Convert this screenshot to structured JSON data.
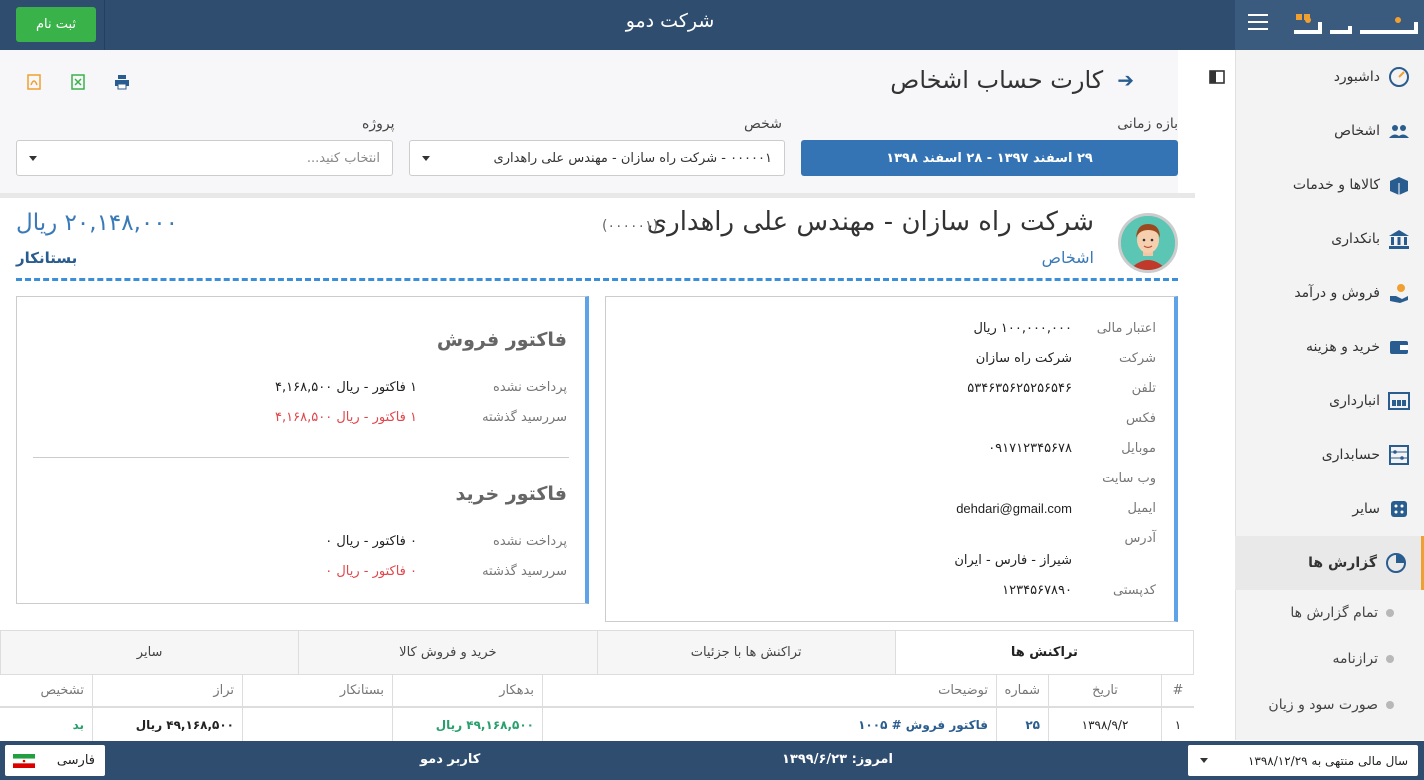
{
  "topbar": {
    "company": "شرکت دمو",
    "signup_label": "ثبت نام"
  },
  "sidebar": {
    "items": [
      {
        "label": "داشبورد",
        "icon": "dashboard-icon"
      },
      {
        "label": "اشخاص",
        "icon": "people-icon"
      },
      {
        "label": "کالاها و خدمات",
        "icon": "box-icon"
      },
      {
        "label": "بانکداری",
        "icon": "bank-icon"
      },
      {
        "label": "فروش و درآمد",
        "icon": "sales-icon"
      },
      {
        "label": "خرید و هزینه",
        "icon": "wallet-icon"
      },
      {
        "label": "انبارداری",
        "icon": "warehouse-icon"
      },
      {
        "label": "حسابداری",
        "icon": "abacus-icon"
      },
      {
        "label": "سایر",
        "icon": "misc-icon"
      },
      {
        "label": "گزارش ها",
        "icon": "report-icon"
      }
    ],
    "sub_items": [
      "تمام گزارش ها",
      "ترازنامه",
      "صورت سود و زیان"
    ]
  },
  "page": {
    "title": "کارت حساب اشخاص",
    "filters": {
      "range_label": "بازه زمانی",
      "range_value": "۲۹ اسفند ۱۳۹۷ - ۲۸ اسفند ۱۳۹۸",
      "person_label": "شخص",
      "person_value": "۰۰۰۰۰۱ - شرکت راه سازان - مهندس علی راهداری",
      "project_label": "پروژه",
      "project_placeholder": "انتخاب کنید..."
    }
  },
  "person": {
    "name": "شرکت راه سازان - مهندس علی راهداری",
    "code": "(۰۰۰۰۰۱)",
    "category": "اشخاص",
    "balance": "۲۰,۱۴۸,۰۰۰ ریال",
    "status": "بستانکار",
    "info": [
      {
        "key": "اعتبار مالی",
        "value": "۱۰۰,۰۰۰,۰۰۰ ریال"
      },
      {
        "key": "شرکت",
        "value": "شرکت راه سازان"
      },
      {
        "key": "تلفن",
        "value": "۵۳۴۶۳۵۶۲۵۲۵۶۵۴۶"
      },
      {
        "key": "فکس",
        "value": ""
      },
      {
        "key": "موبایل",
        "value": "۰۹۱۷۱۲۳۴۵۶۷۸"
      },
      {
        "key": "وب سایت",
        "value": ""
      },
      {
        "key": "ایمیل",
        "value": "dehdari@gmail.com"
      },
      {
        "key": "آدرس",
        "value": ""
      },
      {
        "key": "",
        "value": "شیراز - فارس - ایران"
      },
      {
        "key": "کدپستی",
        "value": "۱۲۳۴۵۶۷۸۹۰"
      }
    ]
  },
  "invoices": {
    "sale": {
      "title": "فاکتور فروش",
      "unpaid_label": "پرداخت نشده",
      "unpaid_value": "۱ فاکتور - ریال ۴,۱۶۸,۵۰۰",
      "overdue_label": "سررسید گذشته",
      "overdue_value": "۱ فاکتور - ریال ۴,۱۶۸,۵۰۰"
    },
    "purchase": {
      "title": "فاکتور خرید",
      "unpaid_label": "پرداخت نشده",
      "unpaid_value": "۰ فاکتور - ریال ۰",
      "overdue_label": "سررسید گذشته",
      "overdue_value": "۰ فاکتور - ریال ۰"
    }
  },
  "tabs": [
    "تراکنش ها",
    "تراکنش ها با جزئیات",
    "خرید و فروش کالا",
    "سایر"
  ],
  "table": {
    "headers": [
      "#",
      "تاریخ",
      "شماره",
      "توضیحات",
      "بدهکار",
      "بستانکار",
      "تراز",
      "تشخیص"
    ],
    "rows": [
      [
        "۱",
        "۱۳۹۸/۹/۲",
        "۲۵",
        "فاکتور فروش # ۱۰۰۵",
        "۴۹,۱۶۸,۵۰۰ ریال",
        "",
        "۴۹,۱۶۸,۵۰۰ ریال",
        "بد"
      ]
    ]
  },
  "footer": {
    "fiscal_year": "سال مالی منتهی به ۱۳۹۸/۱۲/۲۹",
    "today": "امروز: ۱۳۹۹/۶/۲۳",
    "user": "کاربر دمو",
    "language": "فارسی"
  },
  "colors": {
    "topbar": "#2f4d6e",
    "accent": "#3574b4",
    "signup": "#3ab24a",
    "overdue": "#e0474c",
    "debit": "#27a06d"
  }
}
